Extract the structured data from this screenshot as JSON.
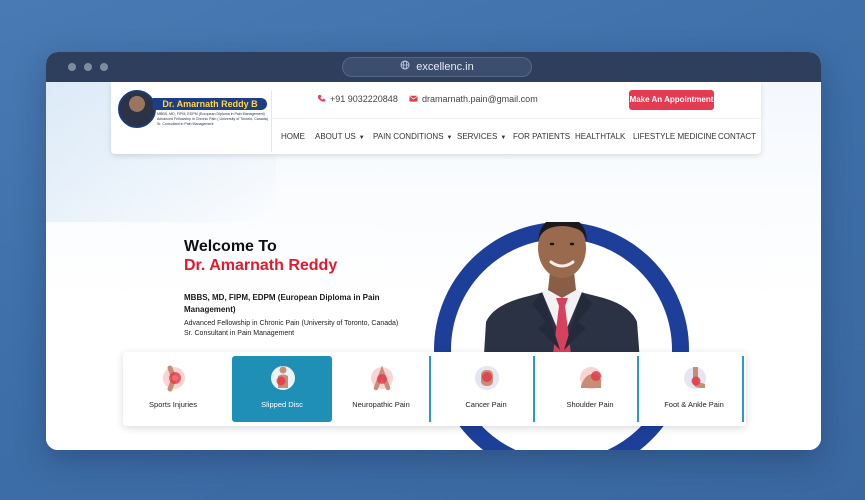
{
  "browser": {
    "url": "excellenc.in"
  },
  "logo": {
    "name": "Dr. Amarnath Reddy B",
    "line1": "MBBS, MD, FIPM, EDPM (European Diploma in Pain Management)",
    "line2": "Advanced Fellowship in Chronic Pain ( University of Toronto, Canada)",
    "line3": "Sr. Consultant in Pain Management"
  },
  "contact": {
    "phone": "+91 9032220848",
    "email": "dramarnath.pain@gmail.com",
    "appointment_label": "Make An Appointment"
  },
  "nav": [
    {
      "label": "HOME",
      "dropdown": false
    },
    {
      "label": "ABOUT US",
      "dropdown": true
    },
    {
      "label": "PAIN CONDITIONS",
      "dropdown": true
    },
    {
      "label": "SERVICES",
      "dropdown": true
    },
    {
      "label": "FOR PATIENTS",
      "dropdown": false
    },
    {
      "label": "HEALTHTALK",
      "dropdown": false
    },
    {
      "label": "LIFESTYLE MEDICINE",
      "dropdown": false
    },
    {
      "label": "CONTACT",
      "dropdown": false
    }
  ],
  "hero": {
    "welcome": "Welcome To",
    "name": "Dr. Amarnath Reddy",
    "degrees": "MBBS, MD, FIPM, EDPM (European Diploma in Pain Management)",
    "fellowship": "Advanced Fellowship in Chronic Pain (University of Toronto, Canada)",
    "consultant": "Sr. Consultant in Pain Management"
  },
  "categories": [
    {
      "label": "Sports Injuries",
      "icon": "knee-pain-icon",
      "active": false
    },
    {
      "label": "Slipped Disc",
      "icon": "back-pain-icon",
      "active": true
    },
    {
      "label": "Neuropathic Pain",
      "icon": "leg-pain-icon",
      "active": false
    },
    {
      "label": "Cancer Pain",
      "icon": "cancer-pain-icon",
      "active": false
    },
    {
      "label": "Shoulder Pain",
      "icon": "shoulder-pain-icon",
      "active": false
    },
    {
      "label": "Foot & Ankle Pain",
      "icon": "ankle-pain-icon",
      "active": false
    }
  ],
  "colors": {
    "accent_red": "#e3192e",
    "button_red": "#e43a52",
    "brand_blue": "#1d3f9a",
    "active_teal": "#1f8fb6"
  }
}
